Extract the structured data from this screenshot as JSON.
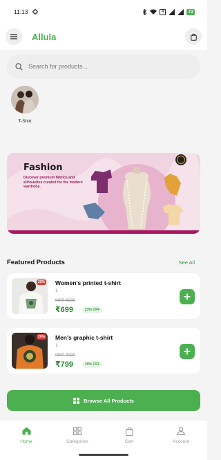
{
  "status_bar": {
    "time": "11:13",
    "battery": "72"
  },
  "app": {
    "name": "Allula"
  },
  "search": {
    "placeholder": "Search for products..."
  },
  "categories": [
    {
      "label": "T-Shirt"
    }
  ],
  "banner": {
    "title": "Fashion",
    "subtitle": "Discover premium fabrics and silhouettes curated for the modern wardrobe."
  },
  "featured": {
    "title": "Featured Products",
    "see_all": "See All",
    "products": [
      {
        "name": "Women's printed t-shirt",
        "qty": "1",
        "mrp": "MRP ₹999",
        "price": "₹699",
        "off": "23% OFF",
        "discount_tag": "22%"
      },
      {
        "name": "Men's graphic t-shirt",
        "qty": "1",
        "mrp": "MRP ₹999",
        "price": "₹799",
        "off": "20% OFF",
        "discount_tag": "20%"
      }
    ]
  },
  "browse_button": {
    "label": "Browse All Products"
  },
  "bottom_nav": [
    {
      "label": "Home",
      "icon": "home-icon",
      "active": true
    },
    {
      "label": "Categories",
      "icon": "grid-icon",
      "active": false
    },
    {
      "label": "Cart",
      "icon": "bag-icon",
      "active": false
    },
    {
      "label": "Account",
      "icon": "person-icon",
      "active": false
    }
  ],
  "colors": {
    "accent": "#4caf50",
    "price": "#2e8b34",
    "discount": "#e53935",
    "banner_bg": "#f6e2ea"
  }
}
